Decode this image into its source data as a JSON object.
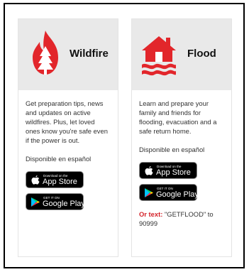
{
  "colors": {
    "accent": "#e2262b",
    "card_header_bg": "#e9e9e9",
    "frame_border": "#000000"
  },
  "cards": [
    {
      "title": "Wildfire",
      "icon": "wildfire-icon",
      "description": "Get preparation tips, news and updates on active wildfires. Plus, let loved ones know you're safe even if the power is out.",
      "spanish": "Disponible en español",
      "app_store": {
        "small": "Download on the",
        "big": "App Store"
      },
      "google_play": {
        "small": "GET IT ON",
        "big": "Google Play"
      }
    },
    {
      "title": "Flood",
      "icon": "flood-house-icon",
      "description": "Learn and prepare your family and friends for flooding, evacuation and a safe return home.",
      "spanish": "Disponible en español",
      "app_store": {
        "small": "Download on the",
        "big": "App Store"
      },
      "google_play": {
        "small": "GET IT ON",
        "big": "Google Play"
      },
      "or_text_label": "Or text:",
      "or_text_value": "\"GETFLOOD\" to 90999"
    }
  ]
}
